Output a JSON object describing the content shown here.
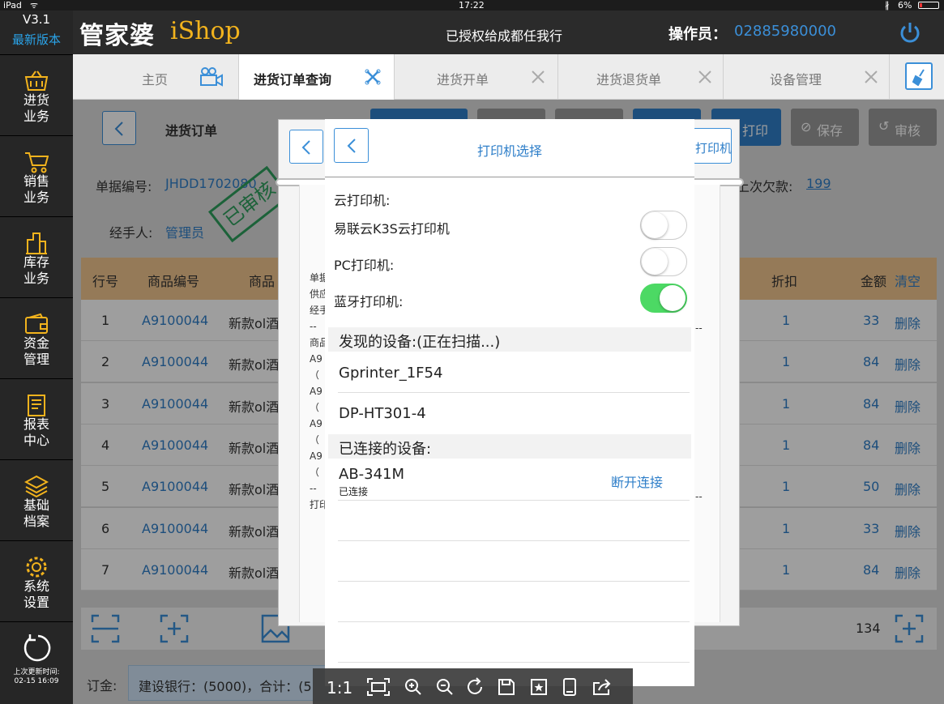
{
  "status": {
    "device": "iPad",
    "time": "17:22",
    "battery": "6%"
  },
  "header": {
    "logo_cn": "管家婆",
    "logo_en": "iShop",
    "auth_text": "已授权给成都任我行",
    "operator_label": "操作员：",
    "operator_value": "02885980000"
  },
  "sidebar": {
    "version": "V3.1",
    "version_sub": "最新版本",
    "items": [
      {
        "line1": "进货",
        "line2": "业务",
        "icon": "basket-icon"
      },
      {
        "line1": "销售",
        "line2": "业务",
        "icon": "cart-icon"
      },
      {
        "line1": "库存",
        "line2": "业务",
        "icon": "building-icon"
      },
      {
        "line1": "资金",
        "line2": "管理",
        "icon": "wallet-icon"
      },
      {
        "line1": "报表",
        "line2": "中心",
        "icon": "report-icon"
      },
      {
        "line1": "基础",
        "line2": "档案",
        "icon": "layers-icon"
      },
      {
        "line1": "系统",
        "line2": "设置",
        "icon": "gear-icon"
      }
    ],
    "refresh_label": "上次更新时间:",
    "refresh_time": "02-15 16:09"
  },
  "tabs": [
    {
      "label": "主页"
    },
    {
      "label": "进货订单查询"
    },
    {
      "label": "进货开单"
    },
    {
      "label": "进货退货单"
    },
    {
      "label": "设备管理"
    }
  ],
  "order": {
    "title": "进货订单",
    "doc_no_label": "单据编号:",
    "doc_no_value": "JHDD1702080",
    "handler_label": "经手人:",
    "handler_value": "管理员",
    "stamp": "已审核",
    "prev_debt_label": "上次欠款:",
    "prev_debt_value": "199",
    "btn_print": "打印",
    "btn_save": "保存",
    "btn_audit": "审核",
    "table_headers": {
      "row_no": "行号",
      "code": "商品编号",
      "name": "商品",
      "discount": "折扣",
      "amount": "金额",
      "clear": "清空"
    },
    "rows": [
      {
        "no": "1",
        "code": "A9100044",
        "name": "新款ol酒",
        "discount": "1",
        "amount": "33",
        "action": "删除"
      },
      {
        "no": "2",
        "code": "A9100044",
        "name": "新款ol酒",
        "discount": "1",
        "amount": "84",
        "action": "删除"
      },
      {
        "no": "3",
        "code": "A9100044",
        "name": "新款ol酒",
        "discount": "1",
        "amount": "84",
        "action": "删除"
      },
      {
        "no": "4",
        "code": "A9100044",
        "name": "新款ol酒",
        "discount": "1",
        "amount": "84",
        "action": "删除"
      },
      {
        "no": "5",
        "code": "A9100044",
        "name": "新款ol酒",
        "discount": "1",
        "amount": "50",
        "action": "删除"
      },
      {
        "no": "6",
        "code": "A9100044",
        "name": "新款ol酒",
        "discount": "1",
        "amount": "33",
        "action": "删除"
      },
      {
        "no": "7",
        "code": "A9100044",
        "name": "新款ol酒",
        "discount": "1",
        "amount": "84",
        "action": "删除"
      }
    ],
    "total_amount": "134",
    "deposit_label": "订金:",
    "deposit_value": "建设银行：(5000)，合计：(5",
    "receipt_lines": [
      "单据",
      "供应",
      "经手",
      "商品",
      "A9",
      "A9",
      "A9",
      "A9",
      "打印"
    ],
    "back_panel_print": "打印机"
  },
  "modal": {
    "title": "打印机选择",
    "cloud_label": "云打印机:",
    "cloud_printer": "易联云K3S云打印机",
    "cloud_on": false,
    "pc_label": "PC打印机:",
    "pc_on": false,
    "bt_label": "蓝牙打印机:",
    "bt_on": true,
    "discovered_header": "发现的设备:(正在扫描...)",
    "discovered": [
      "Gprinter_1F54",
      "DP-HT301-4"
    ],
    "connected_header": "已连接的设备:",
    "connected_name": "AB-341M",
    "connected_status": "已连接",
    "disconnect_label": "断开连接"
  },
  "toolbar": {
    "zoom_label": "1:1"
  },
  "colors": {
    "accent": "#3b8fd8",
    "toggle_on": "#4cd964",
    "logo_en": "#f2b31d",
    "table_head": "#f0c58f"
  }
}
